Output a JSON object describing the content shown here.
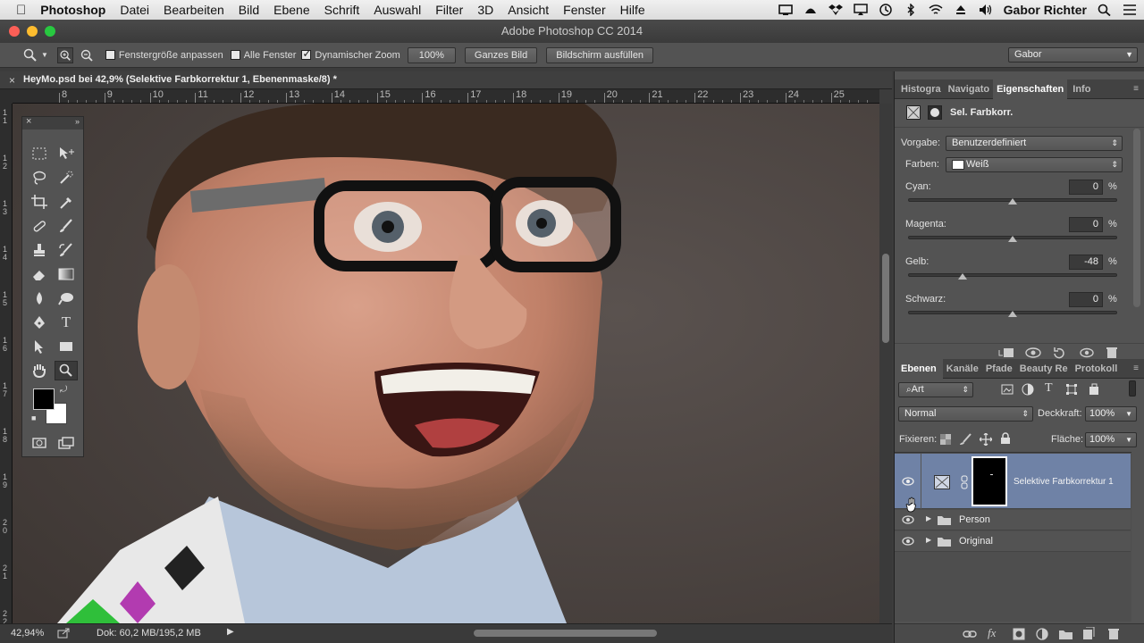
{
  "menubar": {
    "apple": "",
    "items": [
      "Photoshop",
      "Datei",
      "Bearbeiten",
      "Bild",
      "Ebene",
      "Schrift",
      "Auswahl",
      "Filter",
      "3D",
      "Ansicht",
      "Fenster",
      "Hilfe"
    ],
    "user": "Gabor Richter"
  },
  "window": {
    "title": "Adobe Photoshop CC 2014"
  },
  "options": {
    "fit_window_label": "Fenstergröße anpassen",
    "all_windows_label": "Alle Fenster",
    "scrubby_zoom_label": "Dynamischer Zoom",
    "btn_100": "100%",
    "btn_fit_screen": "Ganzes Bild",
    "btn_fill_screen": "Bildschirm ausfüllen",
    "workspace": "Gabor"
  },
  "document": {
    "tab_title": "HeyMo.psd bei 42,9% (Selektive Farbkorrektur 1, Ebenenmaske/8) *",
    "h_ruler_ticks": [
      "8",
      "9",
      "10",
      "11",
      "12",
      "13",
      "14",
      "15",
      "16",
      "17",
      "18",
      "19",
      "20",
      "21",
      "22",
      "23",
      "24",
      "25"
    ],
    "v_ruler_ticks": [
      "1 1",
      "1 2",
      "1 3",
      "1 4",
      "1 5",
      "1 6",
      "1 7",
      "1 8",
      "1 9",
      "2 0",
      "2 1",
      "2 2"
    ]
  },
  "status": {
    "zoom": "42,94%",
    "doc_size": "Dok: 60,2 MB/195,2 MB"
  },
  "properties_panel": {
    "tabs": [
      "Histogra",
      "Navigato",
      "Eigenschaften",
      "Info"
    ],
    "active_tab": "Eigenschaften",
    "header": "Sel. Farbkorr.",
    "preset_label": "Vorgabe:",
    "preset_value": "Benutzerdefiniert",
    "colors_label": "Farben:",
    "colors_value": "Weiß",
    "sliders": [
      {
        "label": "Cyan:",
        "value": "0",
        "unit": "%",
        "level": 0
      },
      {
        "label": "Magenta:",
        "value": "0",
        "unit": "%",
        "level": 0
      },
      {
        "label": "Gelb:",
        "value": "-48",
        "unit": "%",
        "level": -48
      },
      {
        "label": "Schwarz:",
        "value": "0",
        "unit": "%",
        "level": 0
      }
    ]
  },
  "layers_panel": {
    "tabs": [
      "Ebenen",
      "Kanäle",
      "Pfade",
      "Beauty Re",
      "Protokoll"
    ],
    "active_tab": "Ebenen",
    "filter_kind": "Art",
    "blend_mode": "Normal",
    "opacity_label": "Deckkraft:",
    "opacity_value": "100%",
    "lock_label": "Fixieren:",
    "fill_label": "Fläche:",
    "fill_value": "100%",
    "layers": [
      {
        "name": "Selektive Farbkorrektur 1",
        "type": "adjustment",
        "selected": true
      },
      {
        "name": "Person",
        "type": "group",
        "selected": false
      },
      {
        "name": "Original",
        "type": "group",
        "selected": false
      }
    ]
  },
  "colors": {
    "accent_selected": "#6f82a6",
    "foreground": "#000000",
    "background": "#ffffff"
  }
}
